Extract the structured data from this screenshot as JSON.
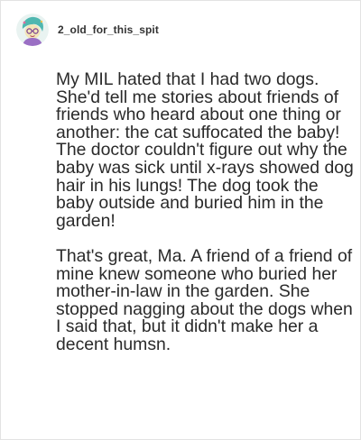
{
  "post": {
    "username": "2_old_for_this_spit",
    "avatar_icon": "cartoon-avatar-icon",
    "paragraphs": [
      "My MIL hated that I had two dogs. She'd tell me stories about friends of friends who heard about one thing or another: the cat suffocated the baby! The doctor couldn't figure out why the baby was sick until x-rays showed dog hair in his lungs! The dog took the baby outside and buried him in the garden!",
      "That's great, Ma. A friend of a friend of mine knew someone who buried her mother-in-law in the garden. She stopped nagging about the dogs when I said that, but it didn't make her a decent humsn."
    ]
  },
  "colors": {
    "border": "#e3e3e3",
    "text": "#2a2a2a",
    "username": "#333333"
  }
}
